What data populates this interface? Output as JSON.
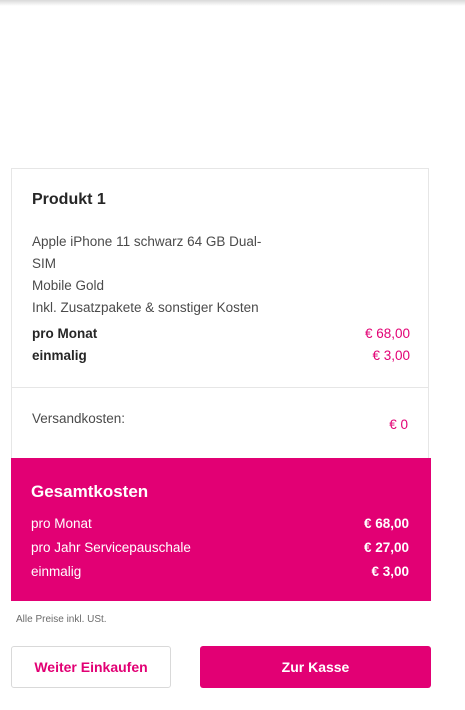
{
  "product": {
    "title": "Produkt 1",
    "description_lines": [
      "Apple iPhone 11 schwarz 64 GB Dual-",
      "SIM",
      "Mobile Gold",
      "Inkl. Zusatzpakete & sonstiger Kosten"
    ],
    "monthly_label": "pro Monat",
    "monthly_value": "€ 68,00",
    "once_label": "einmalig",
    "once_value": "€ 3,00"
  },
  "shipping": {
    "label": "Versandkosten:",
    "value": "€ 0"
  },
  "total": {
    "title": "Gesamtkosten",
    "rows": [
      {
        "label": "pro Monat",
        "value": "€ 68,00"
      },
      {
        "label": "pro Jahr Servicepauschale",
        "value": "€ 27,00"
      },
      {
        "label": "einmalig",
        "value": "€ 3,00"
      }
    ]
  },
  "note": "Alle Preise inkl. USt.",
  "buttons": {
    "continue_shopping": "Weiter Einkaufen",
    "checkout": "Zur Kasse"
  },
  "colors": {
    "brand": "#e20074",
    "border": "#e6e6e6"
  }
}
